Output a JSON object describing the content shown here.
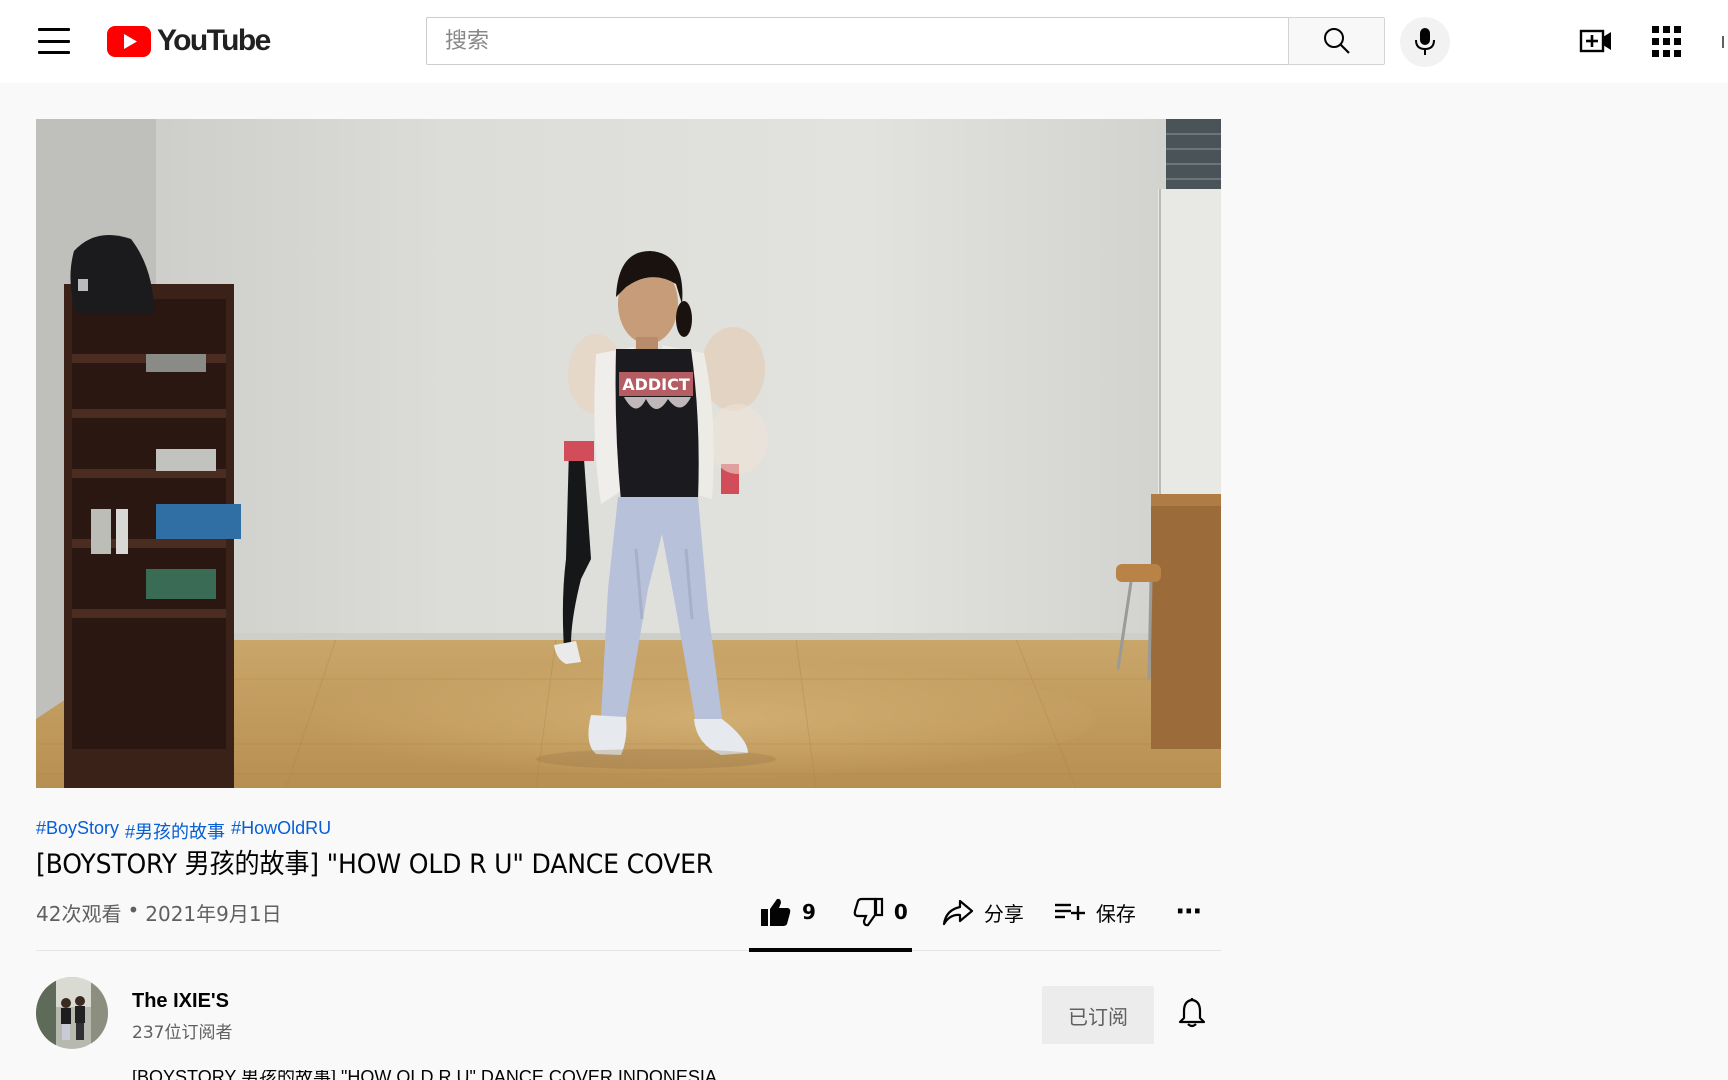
{
  "header": {
    "logo_text": "YouTube",
    "search_placeholder": "搜索",
    "search_value": ""
  },
  "video": {
    "hashtags": [
      "#BoyStory",
      "#男孩的故事",
      "#HowOldRU"
    ],
    "title": "[BOYSTORY 男孩的故事] \"HOW OLD R U\" DANCE COVER",
    "views": "42次观看",
    "separator": "•",
    "date": "2021年9月1日",
    "shirt_text": "ADDICT"
  },
  "actions": {
    "like_count": "9",
    "dislike_count": "0",
    "share_label": "分享",
    "save_label": "保存",
    "more_label": "⋯"
  },
  "channel": {
    "name": "The IXIE'S",
    "subscribers": "237位订阅者",
    "subscribe_button": "已订阅"
  },
  "description": {
    "first_line": "[BOYSTORY 男孩的故事] \"HOW OLD R U\" DANCE COVER INDONESIA"
  },
  "colors": {
    "brand_red": "#ff0000",
    "link_blue": "#065fd4",
    "page_bg": "#f9f9f9",
    "secondary_text": "#606060"
  }
}
